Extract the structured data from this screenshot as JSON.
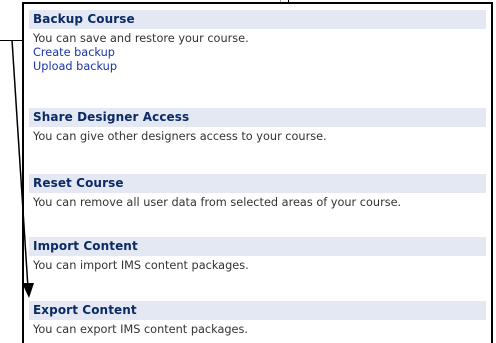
{
  "sections": [
    {
      "title": "Backup Course",
      "description": "You can save and restore your course.",
      "links": [
        "Create backup",
        "Upload backup"
      ]
    },
    {
      "title": "Share Designer Access",
      "description": "You can give other designers access to your course."
    },
    {
      "title": "Reset Course",
      "description": "You can remove all user data from selected areas of your course."
    },
    {
      "title": "Import Content",
      "description": "You can import IMS content packages."
    },
    {
      "title": "Export Content",
      "description": "You can export IMS content packages."
    }
  ],
  "annotation": {
    "icon": "arrow-icon",
    "color": "#000000"
  }
}
